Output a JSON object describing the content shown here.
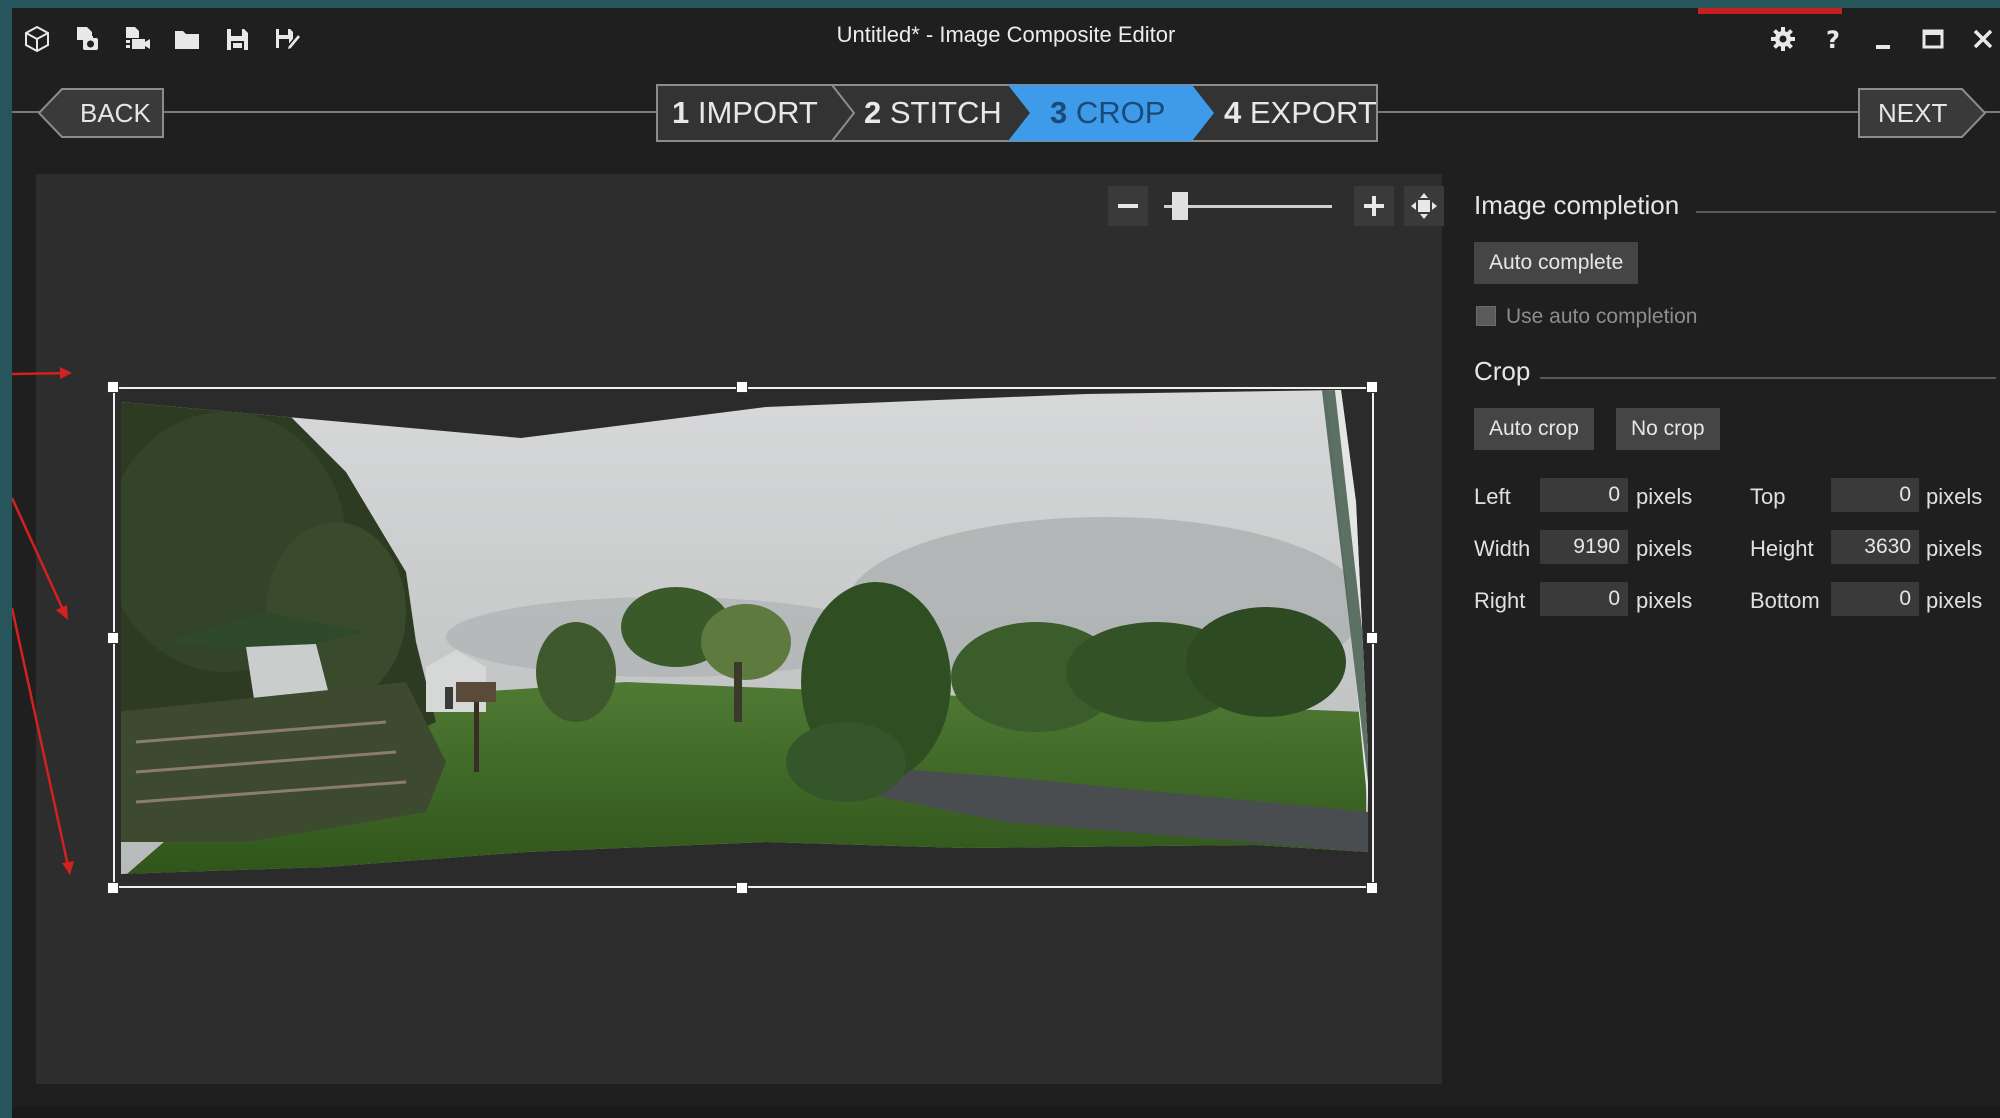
{
  "window": {
    "title": "Untitled* - Image Composite Editor"
  },
  "toolbar_icons": [
    "cube-icon",
    "new-photo-project-icon",
    "new-video-project-icon",
    "open-folder-icon",
    "save-icon",
    "save-as-icon"
  ],
  "window_controls": [
    "gear-icon",
    "help-icon",
    "minimize-icon",
    "maximize-icon",
    "close-icon"
  ],
  "nav": {
    "back_label": "BACK",
    "next_label": "NEXT",
    "steps": [
      {
        "num": "1",
        "label": "IMPORT",
        "active": false
      },
      {
        "num": "2",
        "label": "STITCH",
        "active": false
      },
      {
        "num": "3",
        "label": "CROP",
        "active": true
      },
      {
        "num": "4",
        "label": "EXPORT",
        "active": false
      }
    ],
    "active_color": "#3d9bea"
  },
  "zoom": {
    "level": 0.05
  },
  "image_completion": {
    "title": "Image completion",
    "auto_complete_label": "Auto complete",
    "use_auto_completion_label": "Use auto completion",
    "use_auto_completion_checked": false
  },
  "crop": {
    "title": "Crop",
    "auto_crop_label": "Auto crop",
    "no_crop_label": "No crop",
    "unit": "pixels",
    "fields": {
      "left": {
        "label": "Left",
        "value": "0"
      },
      "top": {
        "label": "Top",
        "value": "0"
      },
      "width": {
        "label": "Width",
        "value": "9190"
      },
      "height": {
        "label": "Height",
        "value": "3630"
      },
      "right": {
        "label": "Right",
        "value": "0"
      },
      "bottom": {
        "label": "Bottom",
        "value": "0"
      }
    }
  },
  "colors": {
    "background": "#1f1f1f",
    "canvas": "#2d2d2d",
    "button": "#454545",
    "annotation_arrow": "#d32020"
  }
}
